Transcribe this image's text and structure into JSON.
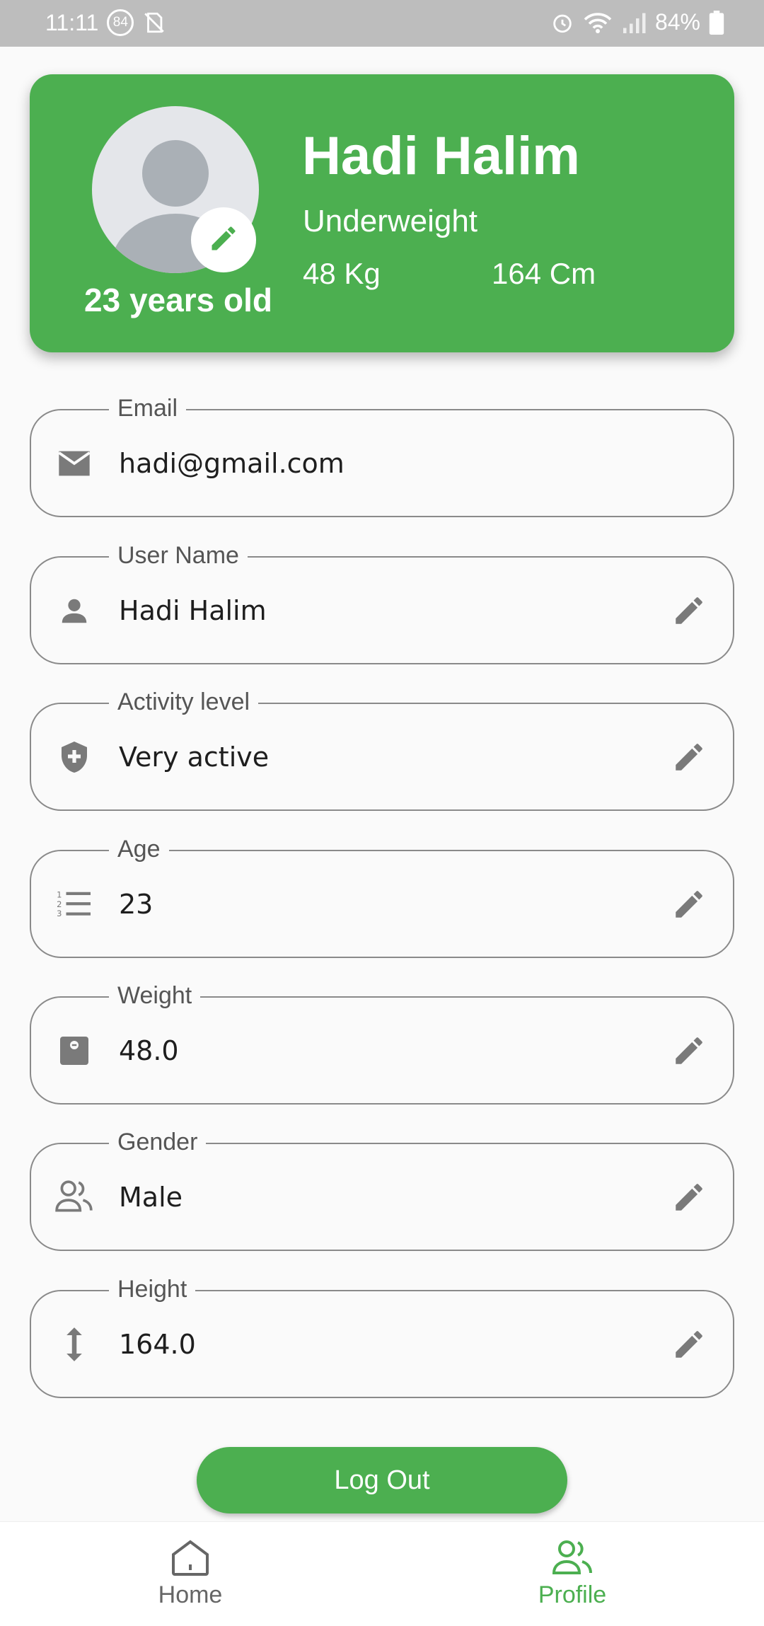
{
  "status_bar": {
    "time": "11:11",
    "notification_count": "84",
    "battery": "84%"
  },
  "profile": {
    "name": "Hadi Halim",
    "status": "Underweight",
    "weight": "48 Kg",
    "height": "164 Cm",
    "age_text": "23 years old"
  },
  "fields": [
    {
      "label": "Email",
      "value": "hadi@gmail.com",
      "icon": "mail-icon",
      "editable": false
    },
    {
      "label": "User Name",
      "value": "Hadi Halim",
      "icon": "person-icon",
      "editable": true
    },
    {
      "label": "Activity level",
      "value": "Very active",
      "icon": "shield-plus-icon",
      "editable": true
    },
    {
      "label": "Age",
      "value": "23",
      "icon": "numbered-list-icon",
      "editable": true
    },
    {
      "label": "Weight",
      "value": "48.0",
      "icon": "scale-icon",
      "editable": true
    },
    {
      "label": "Gender",
      "value": "Male",
      "icon": "people-icon",
      "editable": true
    },
    {
      "label": "Height",
      "value": "164.0",
      "icon": "vertical-arrows-icon",
      "editable": true
    }
  ],
  "logout_label": "Log Out",
  "nav": {
    "home_label": "Home",
    "profile_label": "Profile"
  },
  "colors": {
    "accent": "#4caf50",
    "icon_gray": "#7a7a7a"
  }
}
